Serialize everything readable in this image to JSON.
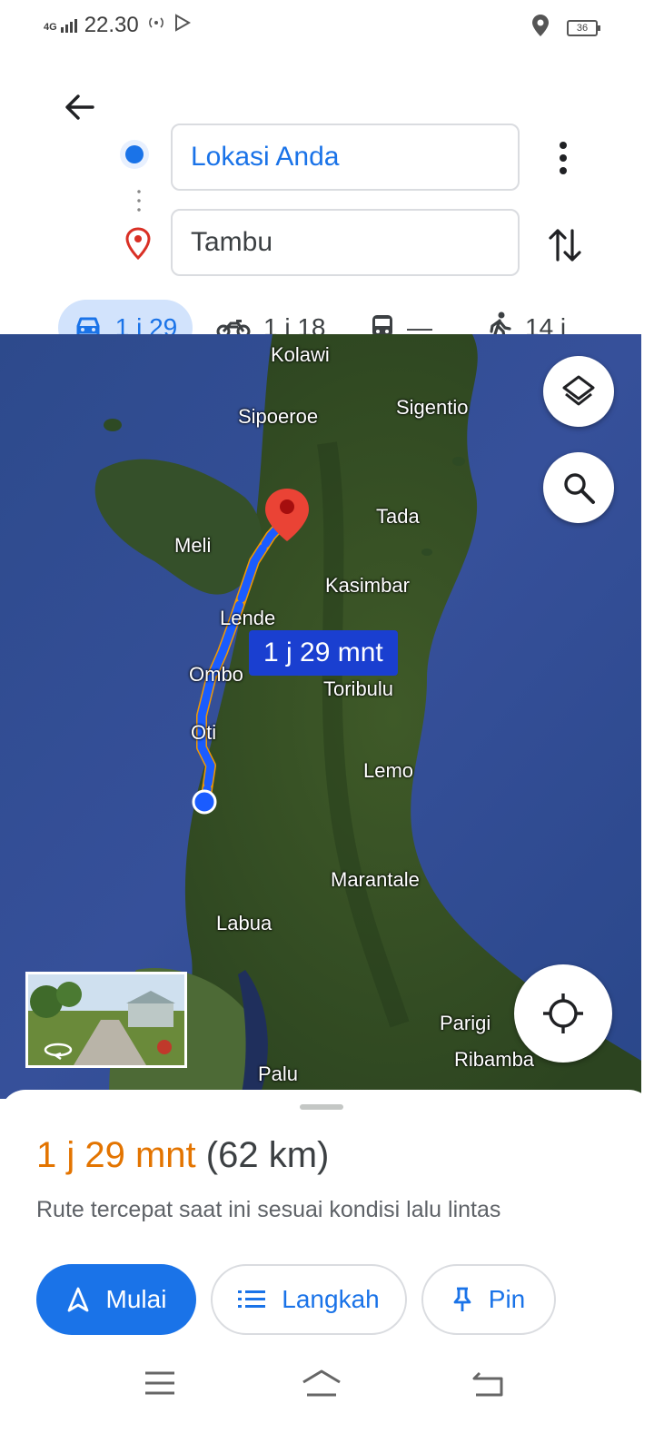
{
  "status_bar": {
    "network": "4G",
    "time": "22.30",
    "battery": "36"
  },
  "directions": {
    "origin": "Lokasi Anda",
    "destination": "Tambu"
  },
  "modes": [
    {
      "icon": "car-icon",
      "label": "1 j 29"
    },
    {
      "icon": "motorcycle-icon",
      "label": "1 j 18"
    },
    {
      "icon": "transit-icon",
      "label": "—"
    },
    {
      "icon": "walk-icon",
      "label": "14 j"
    }
  ],
  "map": {
    "labels": {
      "kolawi": "Kolawi",
      "sipoeroe": "Sipoeroe",
      "sigentio": "Sigentio",
      "tada": "Tada",
      "meli": "Meli",
      "kasimbar": "Kasimbar",
      "lende": "Lende",
      "ombo": "Ombo",
      "toribulu": "Toribulu",
      "oti": "Oti",
      "lemo": "Lemo",
      "marantale": "Marantale",
      "labua": "Labua",
      "parigi": "Parigi",
      "ribamba": "Ribamba",
      "palu": "Palu"
    },
    "eta_bubble": "1 j 29 mnt"
  },
  "route": {
    "duration": "1 j 29 mnt",
    "distance": "(62 km)",
    "description": "Rute tercepat saat ini sesuai kondisi lalu lintas"
  },
  "actions": {
    "start": "Mulai",
    "steps": "Langkah",
    "pin": "Pin"
  },
  "colors": {
    "accent": "#1a73e8",
    "duration": "#e37400",
    "route": "#1a5cff",
    "traffic": "#f29900"
  }
}
